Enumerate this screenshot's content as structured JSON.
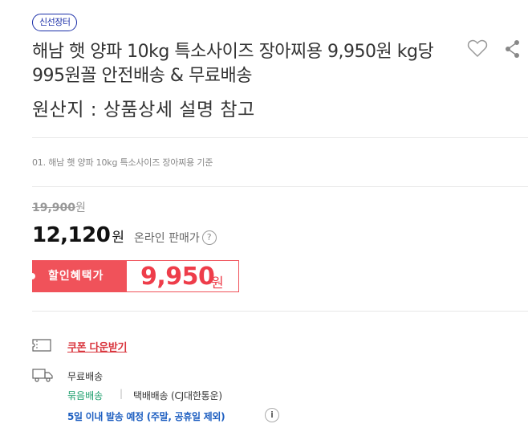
{
  "badge": "신선장터",
  "product": {
    "title": "해남 햇 양파 10kg 특소사이즈 장아찌용 9,950원 kg당 995원꼴 안전배송 & 무료배송",
    "origin": "원산지 : 상품상세 설명 참고",
    "option_note": "01. 해남 햇 양파 10kg 특소사이즈 장아찌용 기준"
  },
  "icons": {
    "wishlist": "heart-outline-icon",
    "share": "share-icon",
    "help": "question-mark-icon",
    "coupon": "coupon-ticket-icon",
    "shipping": "delivery-truck-icon",
    "info": "info-icon"
  },
  "price": {
    "original": "19,900",
    "original_unit": "원",
    "sale": "12,120",
    "sale_unit": "원",
    "sale_label": "온라인 판매가",
    "help_glyph": "?",
    "discount_label": "할인혜택가",
    "discount": "9,950",
    "discount_unit": "원"
  },
  "coupon": {
    "link": "쿠폰 다운받기"
  },
  "shipping": {
    "fee": "무료배송",
    "bundle": "묶음배송",
    "separator": "|",
    "courier": "택배배송 (CJ대한통운)",
    "eta": "5일 이내 발송 예정 (주말, 공휴일 제외)",
    "info_glyph": "i"
  },
  "colors": {
    "badge": "#1a2ea8",
    "discount_bg": "#f0525a",
    "discount_text": "#ee3d4a",
    "coupon_link": "#d9363e",
    "bundle": "#1a9e6b",
    "eta": "#1e5fc1"
  }
}
